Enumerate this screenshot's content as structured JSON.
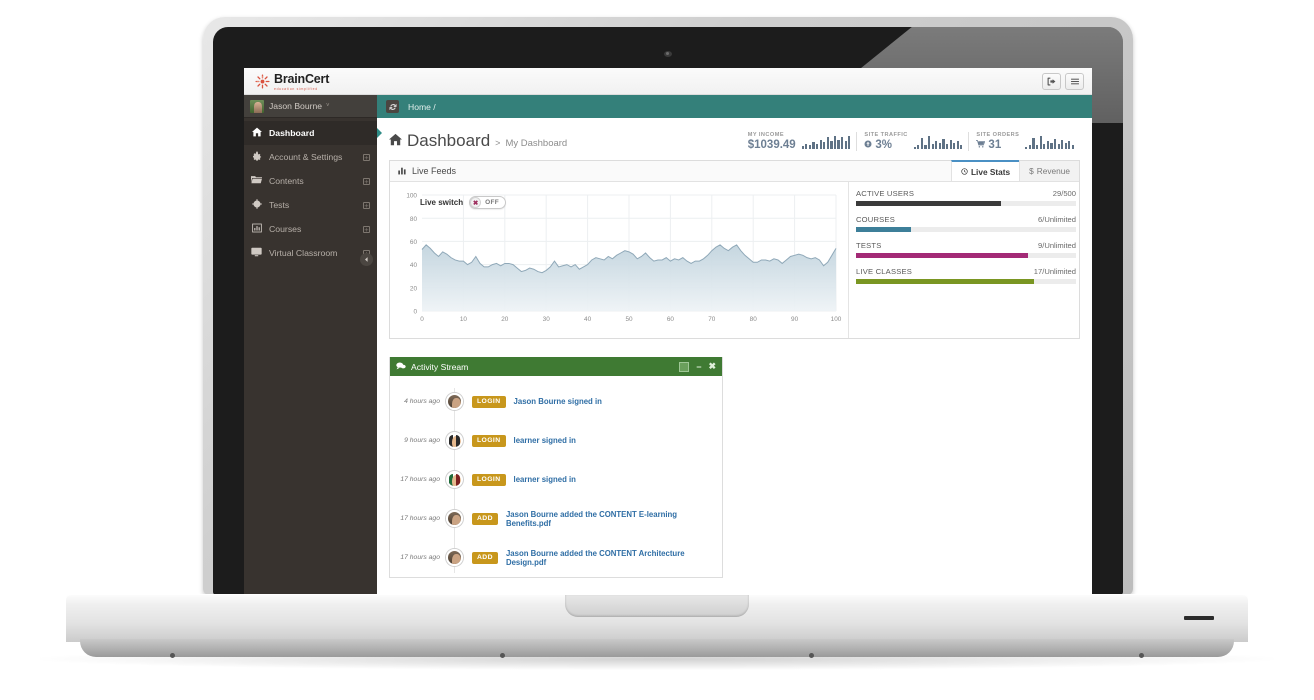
{
  "app": {
    "brand_name": "BrainCert",
    "brand_tagline": "education simplified",
    "logout_icon": "logout-icon",
    "menu_icon": "hamburger-menu-icon"
  },
  "sidebar": {
    "user": {
      "name": "Jason Bourne",
      "caret": "˅",
      "avatar_icon": "user-avatar"
    },
    "items": [
      {
        "label": "Dashboard",
        "icon": "",
        "icon_name": "home-icon",
        "expandable": false,
        "active": true
      },
      {
        "label": "Account & Settings",
        "icon": "⚙",
        "icon_name": "gear-icon",
        "expandable": true,
        "active": false
      },
      {
        "label": "Contents",
        "icon": "🗁",
        "icon_name": "folder-icon",
        "expandable": true,
        "active": false
      },
      {
        "label": "Tests",
        "icon": "⬤",
        "icon_name": "clipboard-icon",
        "expandable": true,
        "active": false
      },
      {
        "label": "Courses",
        "icon": "▦",
        "icon_name": "chart-icon",
        "expandable": true,
        "active": false
      },
      {
        "label": "Virtual Classroom",
        "icon": "⬛",
        "icon_name": "monitor-icon",
        "expandable": true,
        "active": false
      }
    ],
    "expand_glyph": "⊞",
    "collapse_button": {
      "icon": "◀",
      "name": "sidebar-collapse-button"
    }
  },
  "breadcrumb": {
    "refresh_icon": "↻",
    "text": "Home /"
  },
  "page": {
    "home_icon": "🏠",
    "title": "Dashboard",
    "separator": ">",
    "subtitle": "My Dashboard"
  },
  "stats": [
    {
      "caption": "MY INCOME",
      "value": "$1039.49",
      "icon": "",
      "icon_name": "none",
      "spark": [
        2,
        3,
        5,
        4,
        8,
        5,
        9,
        6,
        10,
        7,
        12,
        9,
        11,
        13
      ]
    },
    {
      "caption": "SITE TRAFFIC",
      "value": "3%",
      "icon": "⊕",
      "icon_name": "arrow-up-circle-icon",
      "spark": [
        2,
        3,
        9,
        4,
        12,
        5,
        7,
        6,
        10,
        5,
        9,
        6,
        8,
        4
      ]
    },
    {
      "caption": "SITE ORDERS",
      "value": "31",
      "icon": "🛒",
      "icon_name": "cart-icon",
      "spark": [
        2,
        3,
        9,
        4,
        12,
        5,
        7,
        6,
        10,
        5,
        9,
        6,
        8,
        4
      ]
    }
  ],
  "live_feeds": {
    "panel_title": "Live Feeds",
    "panel_icon": "📊",
    "tabs": [
      {
        "label": "Live Stats",
        "icon": "◴",
        "active": true
      },
      {
        "label": "Revenue",
        "icon": "$",
        "active": false
      }
    ],
    "live_switch": {
      "label": "Live switch",
      "state": "OFF",
      "knob_icon": "✖"
    },
    "rows": [
      {
        "label": "ACTIVE USERS",
        "value": "29/500",
        "percent": 66,
        "color": "#3b3b3b"
      },
      {
        "label": "COURSES",
        "value": "6/Unlimited",
        "percent": 25,
        "color": "#3d7f99"
      },
      {
        "label": "TESTS",
        "value": "9/Unlimited",
        "percent": 78,
        "color": "#a32a76"
      },
      {
        "label": "LIVE CLASSES",
        "value": "17/Unlimited",
        "percent": 81,
        "color": "#7a9622"
      }
    ]
  },
  "chart_data": {
    "type": "area",
    "title": "Live Feeds",
    "xlabel": "",
    "ylabel": "",
    "xlim": [
      0,
      100
    ],
    "ylim": [
      0,
      100
    ],
    "xticks": [
      0,
      10,
      20,
      30,
      40,
      50,
      60,
      70,
      80,
      90,
      100
    ],
    "yticks": [
      0,
      20,
      40,
      60,
      80,
      100
    ],
    "grid": true,
    "line_color": "#8fa8b8",
    "fill_from": "#c2d4de",
    "fill_to": "#eef3f6",
    "x": [
      0,
      1,
      2,
      3,
      4,
      5,
      6,
      7,
      8,
      9,
      10,
      11,
      12,
      13,
      14,
      15,
      16,
      17,
      18,
      19,
      20,
      21,
      22,
      23,
      24,
      25,
      26,
      27,
      28,
      29,
      30,
      31,
      32,
      33,
      34,
      35,
      36,
      37,
      38,
      39,
      40,
      41,
      42,
      43,
      44,
      45,
      46,
      47,
      48,
      49,
      50,
      51,
      52,
      53,
      54,
      55,
      56,
      57,
      58,
      59,
      60,
      61,
      62,
      63,
      64,
      65,
      66,
      67,
      68,
      69,
      70,
      71,
      72,
      73,
      74,
      75,
      76,
      77,
      78,
      79,
      80,
      81,
      82,
      83,
      84,
      85,
      86,
      87,
      88,
      89,
      90,
      91,
      92,
      93,
      94,
      95,
      96,
      97,
      98,
      99,
      100
    ],
    "y": [
      53,
      57,
      54,
      50,
      47,
      51,
      49,
      46,
      44,
      43,
      43,
      40,
      42,
      47,
      41,
      38,
      38,
      40,
      41,
      39,
      41,
      41,
      40,
      37,
      34,
      35,
      37,
      36,
      34,
      33,
      35,
      38,
      43,
      38,
      39,
      40,
      38,
      40,
      36,
      38,
      40,
      44,
      46,
      45,
      44,
      47,
      45,
      48,
      50,
      52,
      51,
      49,
      45,
      47,
      50,
      46,
      43,
      44,
      44,
      46,
      43,
      45,
      44,
      46,
      43,
      41,
      43,
      43,
      45,
      48,
      52,
      55,
      57,
      54,
      52,
      55,
      57,
      52,
      48,
      45,
      42,
      42,
      44,
      44,
      43,
      45,
      44,
      41,
      44,
      47,
      48,
      49,
      48,
      46,
      45,
      46,
      44,
      39,
      42,
      48,
      54
    ]
  },
  "activity_stream": {
    "title": "Activity Stream",
    "title_icon": "💬",
    "buttons": {
      "maximize": "▣",
      "minimize": "−",
      "close": "✖"
    },
    "items": [
      {
        "time": "4 hours ago",
        "badge": "LOGIN",
        "text": "Jason Bourne signed in",
        "avatar": "p1"
      },
      {
        "time": "9 hours ago",
        "badge": "LOGIN",
        "text": "learner signed in",
        "avatar": "p2"
      },
      {
        "time": "17 hours ago",
        "badge": "LOGIN",
        "text": "learner signed in",
        "avatar": "p3"
      },
      {
        "time": "17 hours ago",
        "badge": "ADD",
        "text": "Jason Bourne added the CONTENT E-learning Benefits.pdf",
        "avatar": "p1"
      },
      {
        "time": "17 hours ago",
        "badge": "ADD",
        "text": "Jason Bourne added the CONTENT Architecture Design.pdf",
        "avatar": "p1"
      }
    ]
  }
}
